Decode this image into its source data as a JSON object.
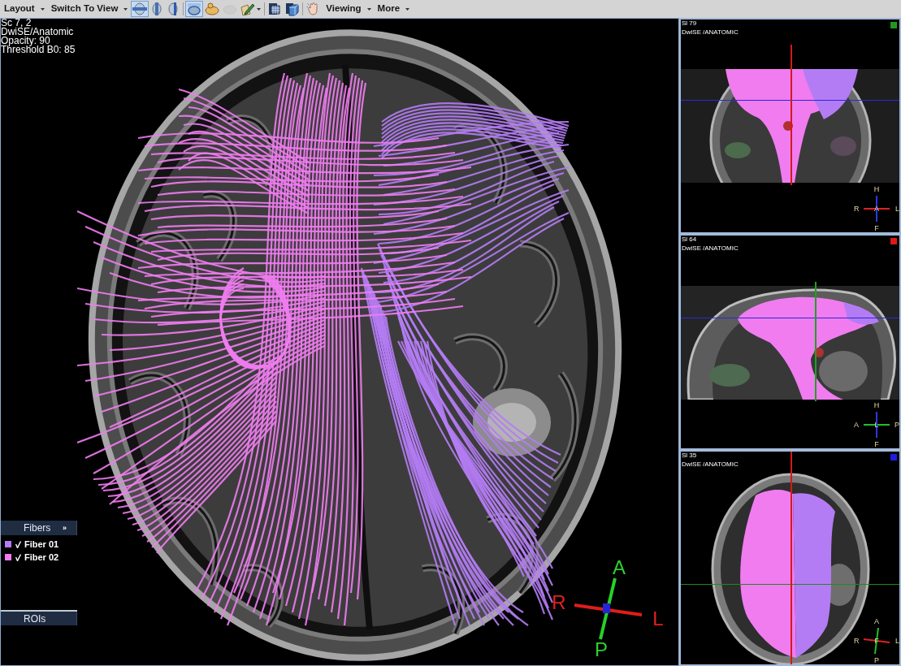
{
  "toolbar": {
    "menus_left": [
      {
        "label": "Layout"
      },
      {
        "label": "Switch To View"
      }
    ],
    "view_buttons": [
      {
        "selected": true
      },
      {
        "selected": false
      },
      {
        "selected": false
      }
    ],
    "render_buttons": [
      {
        "selected": true,
        "disabled": false
      },
      {
        "selected": false,
        "disabled": false
      },
      {
        "selected": false,
        "disabled": true
      }
    ],
    "menus_right": [
      {
        "label": "Viewing"
      },
      {
        "label": "More"
      }
    ]
  },
  "main_view": {
    "info_lines": [
      "Sc 7, 2",
      "DwiSE/Anatomic",
      "Opacity: 90",
      "Threshold B0: 85"
    ],
    "orientation": {
      "top": "A",
      "bottom": "P",
      "left": "R",
      "right": "L"
    }
  },
  "fibers_panel": {
    "title": "Fibers",
    "expand_glyph": "»",
    "items": [
      {
        "label": "Fiber 01",
        "color": "#b47cf4",
        "checked": true
      },
      {
        "label": "Fiber 02",
        "color": "#f07cf0",
        "checked": true
      }
    ]
  },
  "rois_panel": {
    "title": "ROIs"
  },
  "side_views": [
    {
      "kind": "coronal",
      "slice": "Sl 79",
      "series": "DwiSE",
      "label": "/ANATOMIC",
      "color": "#1f9a1f",
      "orientation": {
        "top": "H",
        "bottom": "F",
        "left": "R",
        "right": "L",
        "center": "A"
      }
    },
    {
      "kind": "sagittal",
      "slice": "Sl 64",
      "series": "DwiSE",
      "label": "/ANATOMIC",
      "color": "#e01818",
      "orientation": {
        "top": "H",
        "bottom": "F",
        "left": "A",
        "right": "P",
        "center": "L"
      }
    },
    {
      "kind": "axial",
      "slice": "Sl 35",
      "series": "DwiSE",
      "label": "/ANATOMIC",
      "color": "#1c1ce0",
      "orientation": {
        "top": "A",
        "bottom": "P",
        "left": "R",
        "right": "L",
        "center": "F"
      }
    }
  ]
}
